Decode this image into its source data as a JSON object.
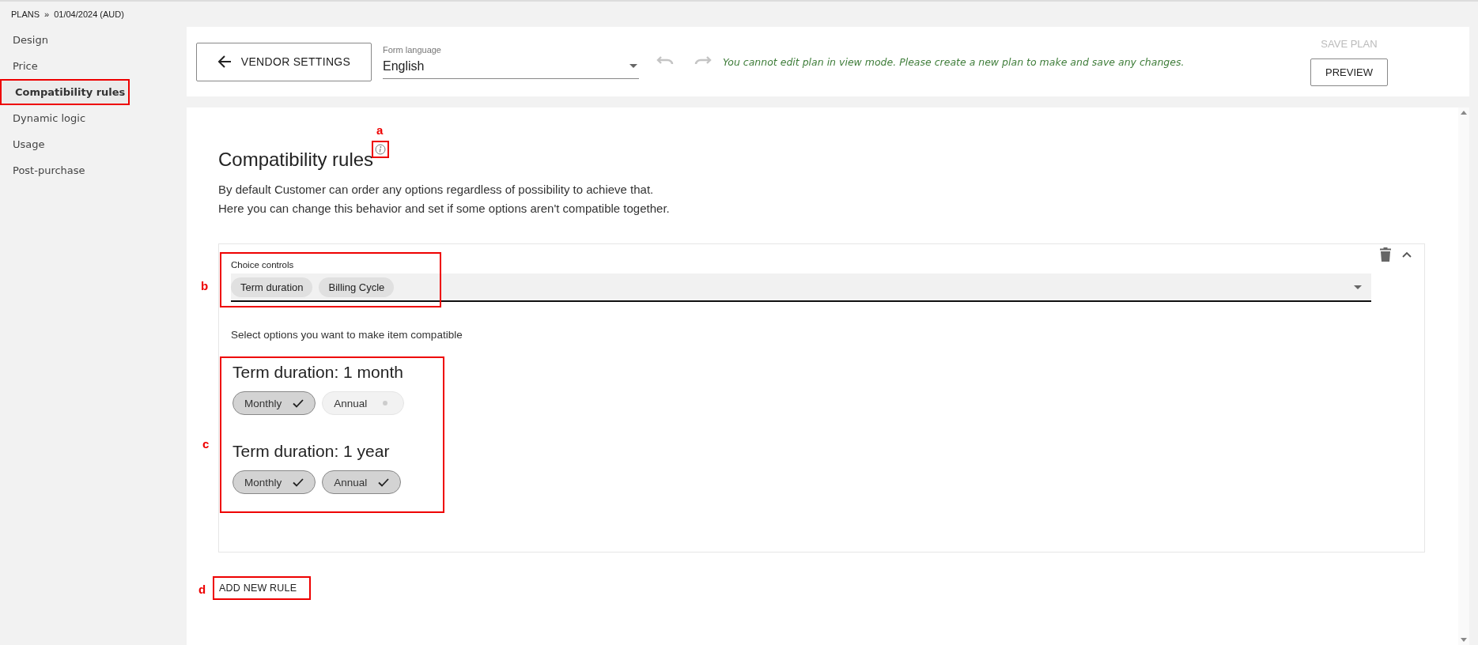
{
  "breadcrumb": {
    "root": "PLANS",
    "separator": "»",
    "current": "01/04/2024 (AUD)"
  },
  "sidebar": {
    "items": [
      {
        "label": "Design",
        "selected": false,
        "highlighted": false
      },
      {
        "label": "Price",
        "selected": false,
        "highlighted": false
      },
      {
        "label": "Compatibility rules",
        "selected": true,
        "highlighted": true
      },
      {
        "label": "Dynamic logic",
        "selected": false,
        "highlighted": false
      },
      {
        "label": "Usage",
        "selected": false,
        "highlighted": false
      },
      {
        "label": "Post-purchase",
        "selected": false,
        "highlighted": false
      }
    ]
  },
  "toolbar": {
    "back_button": "VENDOR SETTINGS",
    "language": {
      "label": "Form language",
      "value": "English"
    },
    "history_buttons": [
      {
        "kind": "undo",
        "disabled": true
      },
      {
        "kind": "redo",
        "disabled": true
      }
    ],
    "message": "You cannot edit plan in view mode. Please create a new plan to make and save any changes.",
    "save_button": {
      "label": "SAVE PLAN",
      "disabled": true
    },
    "preview_button": "PREVIEW"
  },
  "content": {
    "title": "Compatibility rules",
    "info_annotation": "a",
    "description": [
      "By default Customer can order any options regardless of possibility to achieve that.",
      "Here you can change this behavior and set if some options aren't compatible together."
    ],
    "rule": {
      "choice_field": {
        "label": "Choice controls",
        "chips": [
          "Term duration",
          "Billing Cycle"
        ],
        "annotation": "b"
      },
      "instruction": "Select options you want to make item compatible",
      "groups_annotation": "c",
      "groups": [
        {
          "title": "Term duration: 1 month",
          "options": [
            {
              "label": "Monthly",
              "selected": true
            },
            {
              "label": "Annual",
              "selected": false
            }
          ]
        },
        {
          "title": "Term duration: 1 year",
          "options": [
            {
              "label": "Monthly",
              "selected": true
            },
            {
              "label": "Annual",
              "selected": true
            }
          ]
        }
      ]
    },
    "add_rule": {
      "label": "ADD NEW RULE",
      "annotation": "d"
    }
  }
}
